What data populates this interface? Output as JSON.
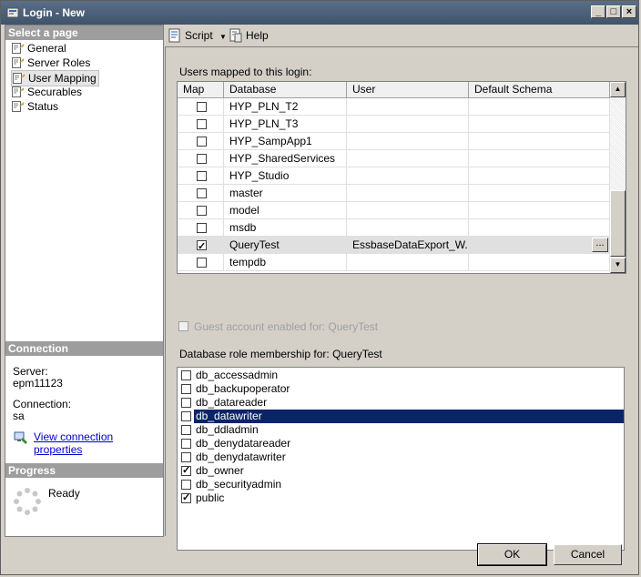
{
  "window": {
    "title": "Login - New"
  },
  "left": {
    "select_page_header": "Select a page",
    "pages": [
      "General",
      "Server Roles",
      "User Mapping",
      "Securables",
      "Status"
    ],
    "selected_page": "User Mapping",
    "connection_header": "Connection",
    "server_label": "Server:",
    "server_value": "epm11123",
    "connection_label": "Connection:",
    "connection_value": "sa",
    "view_conn_link": "View connection properties",
    "progress_header": "Progress",
    "progress_status": "Ready"
  },
  "toolbar": {
    "script_label": "Script",
    "help_label": "Help"
  },
  "mapping": {
    "label": "Users mapped to this login:",
    "columns": [
      "Map",
      "Database",
      "User",
      "Default Schema"
    ],
    "rows": [
      {
        "map": false,
        "database": "HYP_PLN_T2",
        "user": "",
        "schema": ""
      },
      {
        "map": false,
        "database": "HYP_PLN_T3",
        "user": "",
        "schema": ""
      },
      {
        "map": false,
        "database": "HYP_SampApp1",
        "user": "",
        "schema": ""
      },
      {
        "map": false,
        "database": "HYP_SharedServices",
        "user": "",
        "schema": ""
      },
      {
        "map": false,
        "database": "HYP_Studio",
        "user": "",
        "schema": ""
      },
      {
        "map": false,
        "database": "master",
        "user": "",
        "schema": ""
      },
      {
        "map": false,
        "database": "model",
        "user": "",
        "schema": ""
      },
      {
        "map": false,
        "database": "msdb",
        "user": "",
        "schema": ""
      },
      {
        "map": true,
        "database": "QueryTest",
        "user": "EssbaseDataExport_W...",
        "schema": "",
        "selected": true,
        "ellipsis": "..."
      },
      {
        "map": false,
        "database": "tempdb",
        "user": "",
        "schema": ""
      }
    ]
  },
  "guest_label": "Guest account enabled for: QueryTest",
  "roles": {
    "label": "Database role membership for: QueryTest",
    "items": [
      {
        "name": "db_accessadmin",
        "checked": false
      },
      {
        "name": "db_backupoperator",
        "checked": false
      },
      {
        "name": "db_datareader",
        "checked": false
      },
      {
        "name": "db_datawriter",
        "checked": false,
        "selected": true
      },
      {
        "name": "db_ddladmin",
        "checked": false
      },
      {
        "name": "db_denydatareader",
        "checked": false
      },
      {
        "name": "db_denydatawriter",
        "checked": false
      },
      {
        "name": "db_owner",
        "checked": true
      },
      {
        "name": "db_securityadmin",
        "checked": false
      },
      {
        "name": "public",
        "checked": true
      }
    ]
  },
  "buttons": {
    "ok": "OK",
    "cancel": "Cancel"
  },
  "colors": {
    "titlebar": "#4a5d76",
    "selection": "#0a246a",
    "panel_header": "#9d9d9d"
  }
}
